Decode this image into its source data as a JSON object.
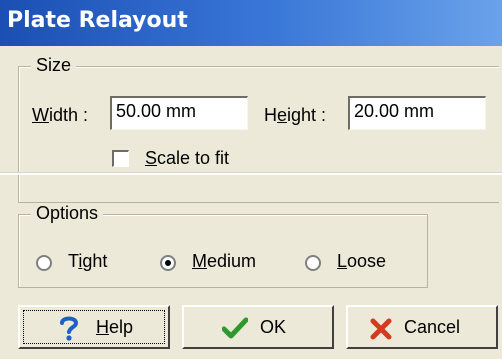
{
  "window": {
    "title": "Plate Relayout"
  },
  "size_group": {
    "legend": "Size",
    "width_label": "Width :",
    "width_value": "50.00 mm",
    "height_label": "Height :",
    "height_value": "20.00 mm",
    "scale_to_fit_label": "Scale to fit",
    "scale_to_fit_checked": false
  },
  "options_group": {
    "legend": "Options",
    "radios": [
      {
        "label": "Tight",
        "selected": false
      },
      {
        "label": "Medium",
        "selected": true
      },
      {
        "label": "Loose",
        "selected": false
      }
    ]
  },
  "buttons": {
    "help": {
      "label": "Help",
      "icon": "help-question-icon"
    },
    "ok": {
      "label": "OK",
      "icon": "checkmark-icon"
    },
    "cancel": {
      "label": "Cancel",
      "icon": "cancel-x-icon"
    }
  },
  "colors": {
    "title_bar_start": "#1b4fb3",
    "title_bar_end": "#6aa2ea",
    "window_bg": "#ece9d8",
    "ok_check": "#2e9a2e",
    "cancel_x": "#d63a1e",
    "help_icon": "#1e5fc8"
  }
}
